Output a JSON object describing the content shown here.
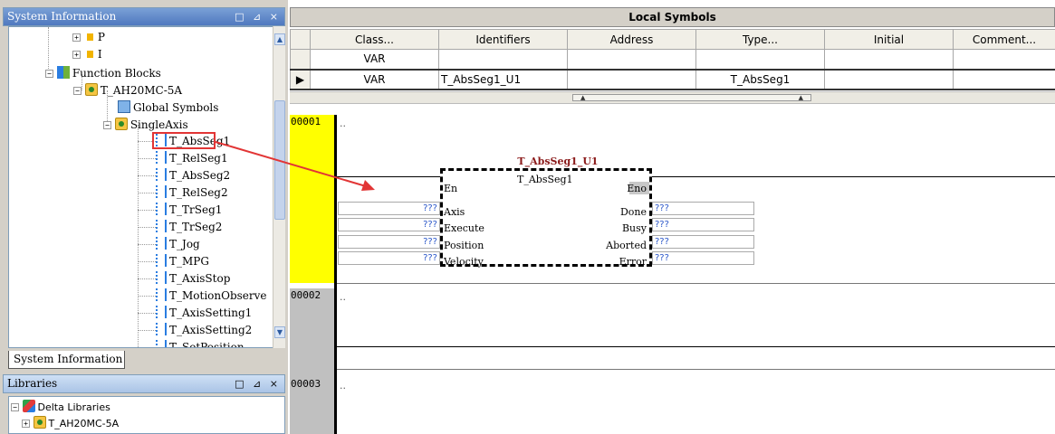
{
  "system_info": {
    "title": "System Information",
    "controls": "□ ⊿ ×",
    "tab_label": "System Information"
  },
  "tree": {
    "items": [
      {
        "label": "P"
      },
      {
        "label": "I"
      },
      {
        "label": "Function Blocks"
      },
      {
        "label": "T_AH20MC-5A"
      },
      {
        "label": "Global Symbols"
      },
      {
        "label": "SingleAxis"
      },
      {
        "label": "T_AbsSeg1"
      },
      {
        "label": "T_RelSeg1"
      },
      {
        "label": "T_AbsSeg2"
      },
      {
        "label": "T_RelSeg2"
      },
      {
        "label": "T_TrSeg1"
      },
      {
        "label": "T_TrSeg2"
      },
      {
        "label": "T_Jog"
      },
      {
        "label": "T_MPG"
      },
      {
        "label": "T_AxisStop"
      },
      {
        "label": "T_MotionObserve"
      },
      {
        "label": "T_AxisSetting1"
      },
      {
        "label": "T_AxisSetting2"
      },
      {
        "label": "T_SetPosition"
      }
    ]
  },
  "libraries": {
    "title": "Libraries",
    "controls": "□ ⊿ ×",
    "items": [
      {
        "label": "Delta Libraries"
      },
      {
        "label": "T_AH20MC-5A"
      }
    ]
  },
  "local_symbols": {
    "title": "Local Symbols",
    "columns": [
      "Class...",
      "Identifiers",
      "Address",
      "Type...",
      "Initial",
      "Comment..."
    ],
    "rows": [
      {
        "class": "VAR",
        "identifier": "",
        "address": "",
        "type": "",
        "initial": "",
        "comment": ""
      },
      {
        "class": "VAR",
        "identifier": "T_AbsSeg1_U1",
        "address": "",
        "type": "T_AbsSeg1",
        "initial": "",
        "comment": ""
      }
    ]
  },
  "ladder": {
    "rungs": [
      {
        "number": "00001",
        "dots": ".."
      },
      {
        "number": "00002",
        "dots": ".."
      },
      {
        "number": "00003",
        "dots": ".."
      }
    ],
    "function_block": {
      "instance_name": "T_AbsSeg1_U1",
      "type_name": "T_AbsSeg1",
      "en": "En",
      "eno": "Eno",
      "inputs": [
        {
          "name": "Axis",
          "value": "???"
        },
        {
          "name": "Execute",
          "value": "???"
        },
        {
          "name": "Position",
          "value": "???"
        },
        {
          "name": "Velocity",
          "value": "???"
        }
      ],
      "outputs": [
        {
          "name": "Done",
          "value": "???"
        },
        {
          "name": "Busy",
          "value": "???"
        },
        {
          "name": "Aborted",
          "value": "???"
        },
        {
          "name": "Error",
          "value": "???"
        }
      ]
    }
  },
  "colors": {
    "rung_active": "#ffff00",
    "rung_inactive": "#c0c0c0",
    "highlight": "#e23535",
    "fb_title": "#8b1a1a",
    "param_text": "#2b57c9"
  }
}
